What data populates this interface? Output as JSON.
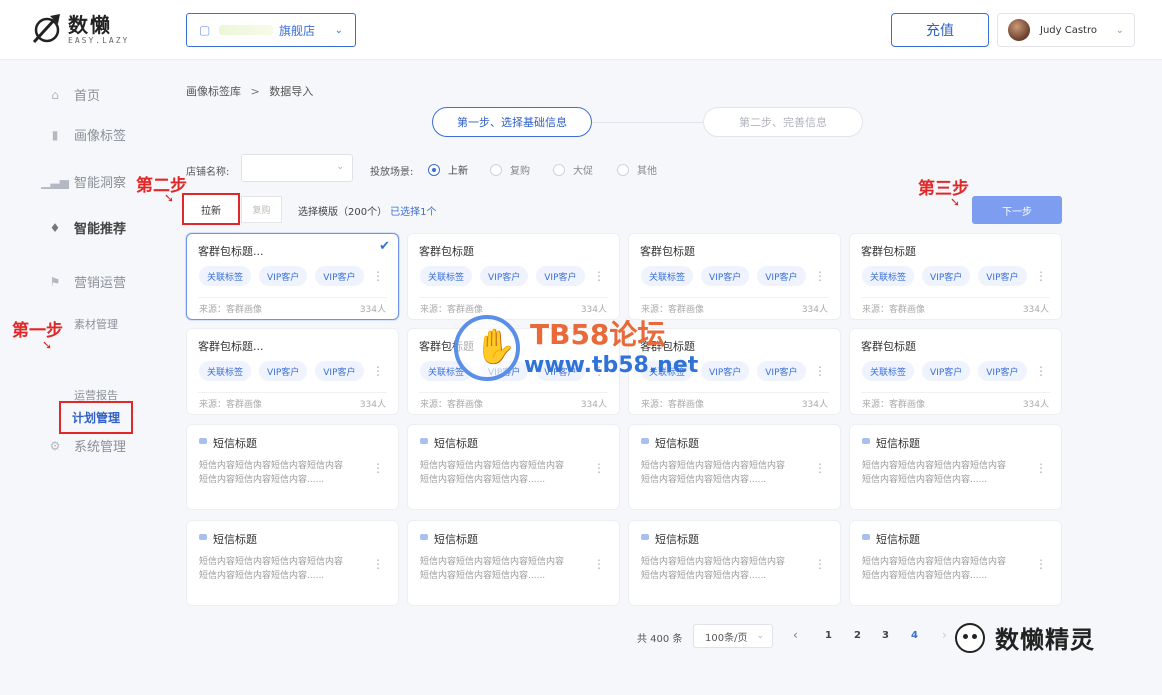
{
  "header": {
    "logo_main": "数懒",
    "logo_sub": "EASY.LAZY",
    "store_icon": "shop-icon",
    "store_name": "旗舰店",
    "recharge_label": "充值",
    "user_name": "Judy Castro"
  },
  "sidebar": {
    "items": [
      {
        "label": "首页",
        "icon": "home-icon"
      },
      {
        "label": "画像标签",
        "icon": "bookmark-icon"
      },
      {
        "label": "智能洞察",
        "icon": "bar-chart-icon"
      },
      {
        "label": "智能推荐",
        "icon": "thumbs-up-icon"
      },
      {
        "label": "营销运营",
        "icon": "flag-icon"
      },
      {
        "label": "系统管理",
        "icon": "gear-icon"
      }
    ],
    "sub_items": [
      "素材管理",
      "计划管理",
      "运营报告"
    ]
  },
  "annotations": {
    "step_one": "第一步",
    "step_two": "第二步",
    "step_three": "第三步"
  },
  "breadcrumb": {
    "root": "画像标签库",
    "sep": ">",
    "current": "数据导入"
  },
  "steps": {
    "step1": "第一步、选择基础信息",
    "step2": "第二步、完善信息"
  },
  "form": {
    "shop_label": "店铺名称:",
    "scene_label": "投放场景:",
    "scenes": [
      "上新",
      "复购",
      "大促",
      "其他"
    ],
    "selected_scene": "上新"
  },
  "template_tabs": {
    "laxin": "拉新",
    "fugou": "复购"
  },
  "template_info": {
    "text": "选择模版（200个）",
    "selected": "已选择1个"
  },
  "next_label": "下一步",
  "crowd_cards": {
    "row1": [
      {
        "title": "客群包标题...",
        "tags": [
          "关联标签",
          "VIP客户",
          "VIP客户"
        ],
        "source": "来源：客群画像",
        "count": "334人"
      },
      {
        "title": "客群包标题",
        "tags": [
          "关联标签",
          "VIP客户",
          "VIP客户"
        ],
        "source": "来源：客群画像",
        "count": "334人"
      },
      {
        "title": "客群包标题",
        "tags": [
          "关联标签",
          "VIP客户",
          "VIP客户"
        ],
        "source": "来源：客群画像",
        "count": "334人"
      },
      {
        "title": "客群包标题",
        "tags": [
          "关联标签",
          "VIP客户",
          "VIP客户"
        ],
        "source": "来源：客群画像",
        "count": "334人"
      }
    ],
    "row2": [
      {
        "title": "客群包标题...",
        "tags": [
          "关联标签",
          "VIP客户",
          "VIP客户"
        ],
        "source": "来源：客群画像",
        "count": "334人"
      },
      {
        "title": "客群包标题",
        "tags": [
          "关联标签",
          "VIP客户",
          "VIP客户"
        ],
        "source": "来源：客群画像",
        "count": "334人"
      },
      {
        "title": "客群包标题",
        "tags": [
          "关联标签",
          "VIP客户",
          "VIP客户"
        ],
        "source": "来源：客群画像",
        "count": "334人"
      },
      {
        "title": "客群包标题",
        "tags": [
          "关联标签",
          "VIP客户",
          "VIP客户"
        ],
        "source": "来源：客群画像",
        "count": "334人"
      }
    ]
  },
  "sms_cards": {
    "title": "短信标题",
    "line1": "短信内容短信内容短信内容短信内容",
    "line2": "短信内容短信内容短信内容......"
  },
  "watermark": {
    "title": "TB58论坛",
    "url": "www.tb58.net"
  },
  "pagination": {
    "total": "共 400 条",
    "page_size": "100条/页",
    "pages": [
      "1",
      "2",
      "3",
      "4"
    ],
    "current": "4"
  },
  "wechat_account": "数懒精灵"
}
